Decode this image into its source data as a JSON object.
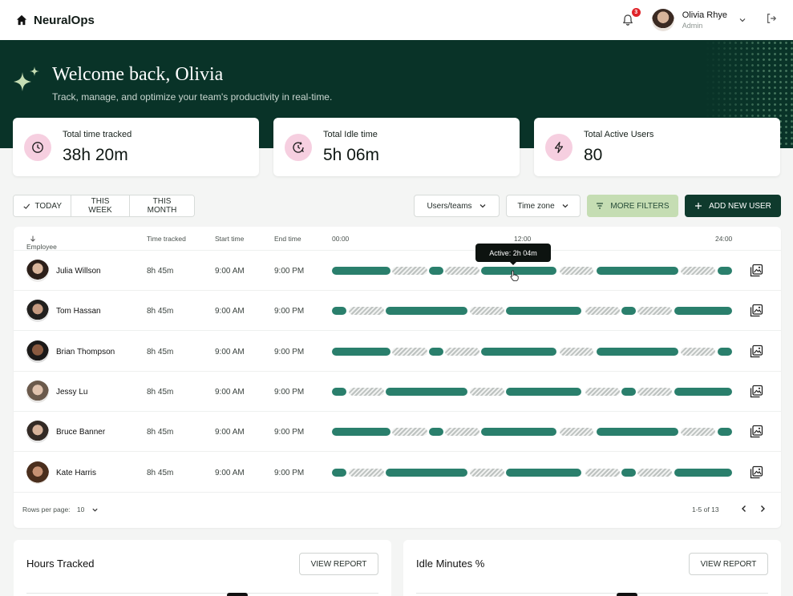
{
  "app": {
    "brand": "NeuralOps"
  },
  "header": {
    "notification_count": "3",
    "user_name": "Olivia Rhye",
    "user_role": "Admin"
  },
  "hero": {
    "title": "Welcome back, Olivia",
    "subtitle": "Track, manage, and optimize your team's productivity in real-time."
  },
  "stats": [
    {
      "label": "Total time tracked",
      "value": "38h 20m",
      "icon": "clock-icon"
    },
    {
      "label": "Total Idle time",
      "value": "5h 06m",
      "icon": "clock-refresh-icon"
    },
    {
      "label": "Total Active Users",
      "value": "80",
      "icon": "lightning-icon"
    }
  ],
  "filters": {
    "period": [
      "TODAY",
      "THIS WEEK",
      "THIS MONTH"
    ],
    "selected_period": "TODAY",
    "users_teams": "Users/teams",
    "time_zone": "Time zone",
    "more_filters": "MORE FILTERS",
    "add_user": "ADD NEW USER"
  },
  "table": {
    "columns": {
      "employee": "Employee",
      "time_tracked": "Time tracked",
      "start_time": "Start time",
      "end_time": "End time",
      "t0": "00:00",
      "t12": "12:00",
      "t24": "24:00"
    },
    "tooltip": "Active: 2h 04m",
    "rows": [
      {
        "name": "Julia Willson",
        "tracked": "8h 45m",
        "start": "9:00 AM",
        "end": "9:00 PM",
        "pattern": "a"
      },
      {
        "name": "Tom Hassan",
        "tracked": "8h 45m",
        "start": "9:00 AM",
        "end": "9:00 PM",
        "pattern": "b"
      },
      {
        "name": "Brian Thompson",
        "tracked": "8h 45m",
        "start": "9:00 AM",
        "end": "9:00 PM",
        "pattern": "a"
      },
      {
        "name": "Jessy Lu",
        "tracked": "8h 45m",
        "start": "9:00 AM",
        "end": "9:00 PM",
        "pattern": "b"
      },
      {
        "name": "Bruce Banner",
        "tracked": "8h 45m",
        "start": "9:00 AM",
        "end": "9:00 PM",
        "pattern": "a"
      },
      {
        "name": "Kate Harris",
        "tracked": "8h 45m",
        "start": "9:00 AM",
        "end": "9:00 PM",
        "pattern": "b"
      }
    ],
    "rows_per_page_label": "Rows per page:",
    "rows_per_page": "10",
    "range": "1-5 of 13"
  },
  "cards": [
    {
      "title": "Hours Tracked",
      "button": "VIEW REPORT"
    },
    {
      "title": "Idle Minutes %",
      "button": "VIEW REPORT"
    }
  ],
  "colors": {
    "brand_dark": "#093328",
    "active": "#2a7f6c",
    "accent_pink": "#f6cfe0",
    "filter_green": "#c5ddb3"
  }
}
